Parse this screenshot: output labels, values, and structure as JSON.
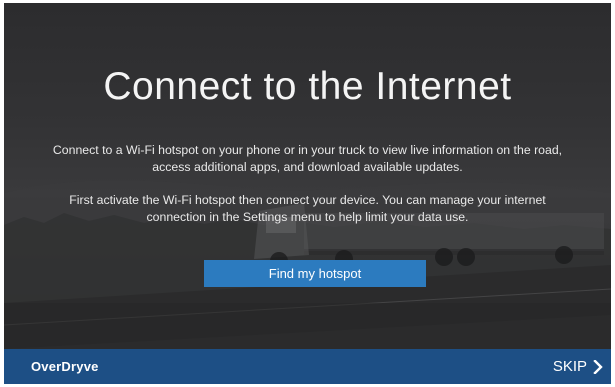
{
  "hero": {
    "title": "Connect to the Internet",
    "paragraph1": "Connect to a Wi-Fi hotspot on your phone or in your truck to view live information on the road, access additional apps, and download available updates.",
    "paragraph2": "First activate the Wi-Fi hotspot then connect your device. You can manage your internet connection in the Settings menu to help limit your data use.",
    "primary_button": "Find my hotspot",
    "background": "truck-on-road-photo"
  },
  "footer": {
    "brand": "OverDryve",
    "skip_label": "SKIP",
    "skip_icon": "chevron-right-icon"
  },
  "colors": {
    "accent_button": "#2c7bbf",
    "footer_bar": "#1d4f85",
    "text": "#ffffff"
  }
}
